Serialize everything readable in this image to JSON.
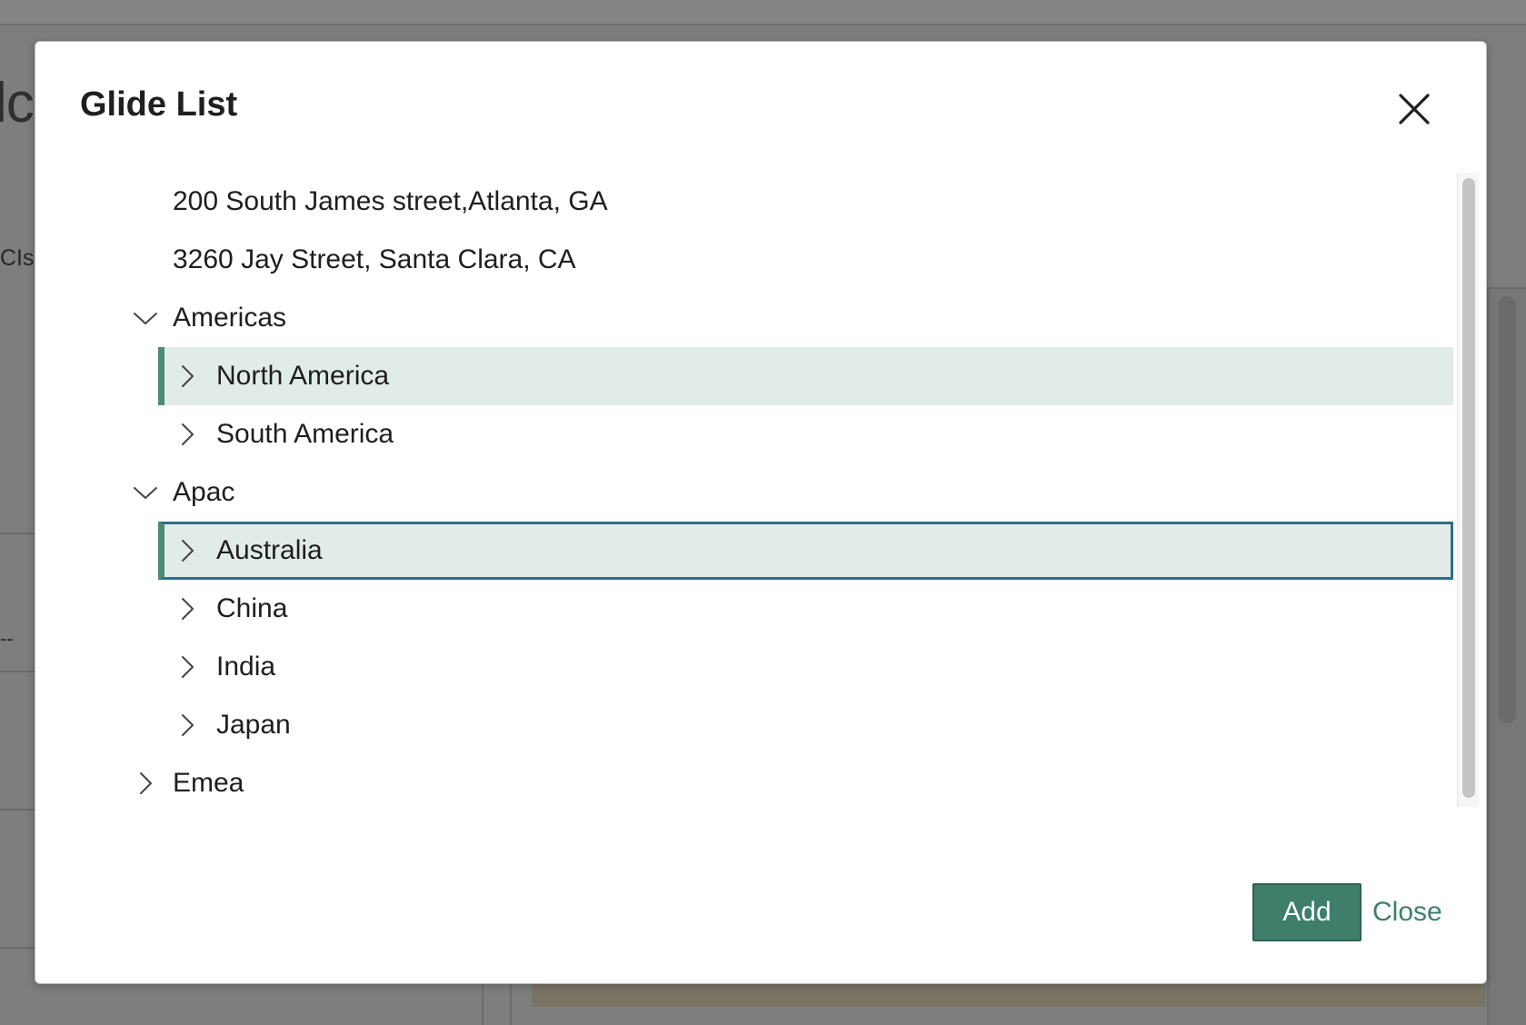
{
  "background": {
    "heading_fragment": "lc",
    "label_fragment": "CIs",
    "dash_fragment": "--"
  },
  "modal": {
    "title": "Glide List",
    "close_icon": "close-x-icon",
    "tree": [
      {
        "id": "n1",
        "label": "200 South James street,Atlanta, GA",
        "level": 0,
        "expandable": false,
        "expanded": false
      },
      {
        "id": "n2",
        "label": "3260 Jay Street, Santa Clara, CA",
        "level": 0,
        "expandable": false,
        "expanded": false
      },
      {
        "id": "n3",
        "label": "Americas",
        "level": 0,
        "expandable": true,
        "expanded": true
      },
      {
        "id": "n4",
        "label": "North America",
        "level": 1,
        "expandable": true,
        "expanded": false,
        "state": "hover"
      },
      {
        "id": "n5",
        "label": "South America",
        "level": 1,
        "expandable": true,
        "expanded": false
      },
      {
        "id": "n6",
        "label": "Apac",
        "level": 0,
        "expandable": true,
        "expanded": true
      },
      {
        "id": "n7",
        "label": "Australia",
        "level": 1,
        "expandable": true,
        "expanded": false,
        "state": "focused"
      },
      {
        "id": "n8",
        "label": "China",
        "level": 1,
        "expandable": true,
        "expanded": false
      },
      {
        "id": "n9",
        "label": "India",
        "level": 1,
        "expandable": true,
        "expanded": false
      },
      {
        "id": "n10",
        "label": "Japan",
        "level": 1,
        "expandable": true,
        "expanded": false
      },
      {
        "id": "n11",
        "label": "Emea",
        "level": 0,
        "expandable": true,
        "expanded": false
      }
    ],
    "buttons": {
      "add_label": "Add",
      "close_label": "Close"
    }
  },
  "colors": {
    "accent": "#3e7e6b",
    "row_highlight": "#e1ece9",
    "focus_border": "#2b6f86",
    "overlay": "#7e7e7e"
  }
}
